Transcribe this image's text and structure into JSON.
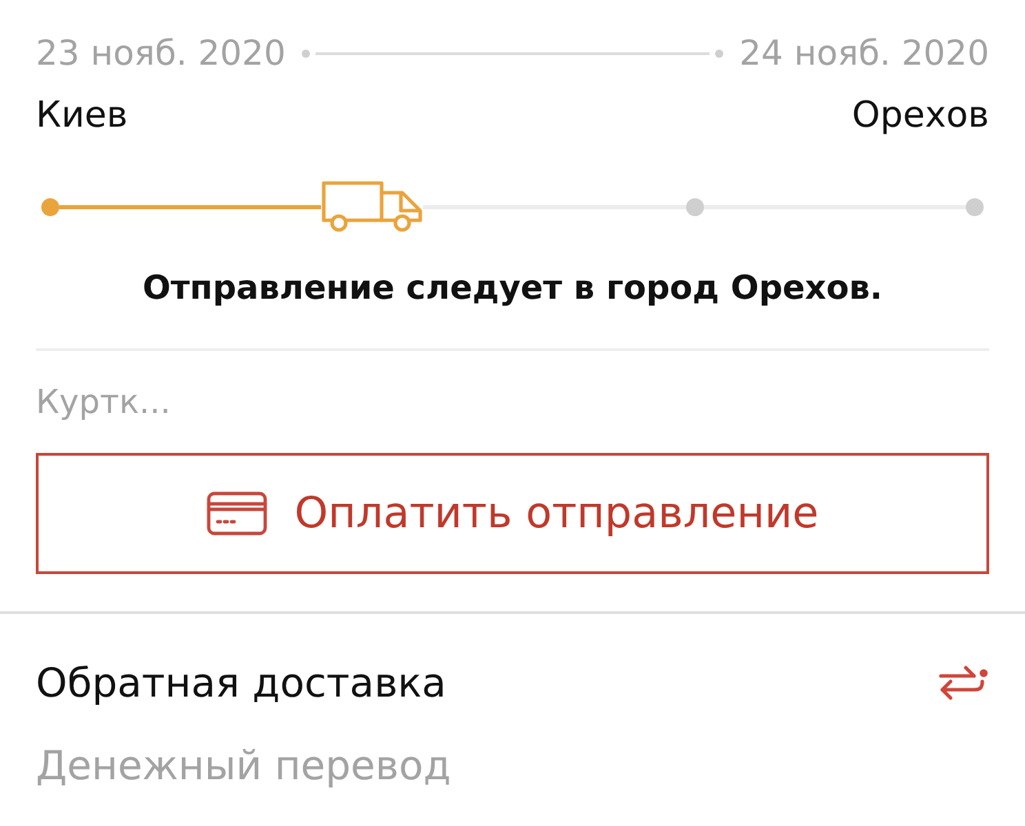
{
  "shipment": {
    "departure": {
      "date": "23 нояб. 2020",
      "city": "Киев"
    },
    "arrival": {
      "date": "24 нояб. 2020",
      "city": "Орехов"
    }
  },
  "progress": {
    "stops": [
      {
        "kind": "passed"
      },
      {
        "kind": "current"
      },
      {
        "kind": "upcoming"
      },
      {
        "kind": "upcoming"
      }
    ]
  },
  "status_message": "Отправление следует в город Орехов.",
  "contents": "Куртк...",
  "pay_button": {
    "label": "Оплатить отправление"
  },
  "return_delivery": {
    "title": "Обратная доставка",
    "subtitle": "Денежный перевод"
  }
}
